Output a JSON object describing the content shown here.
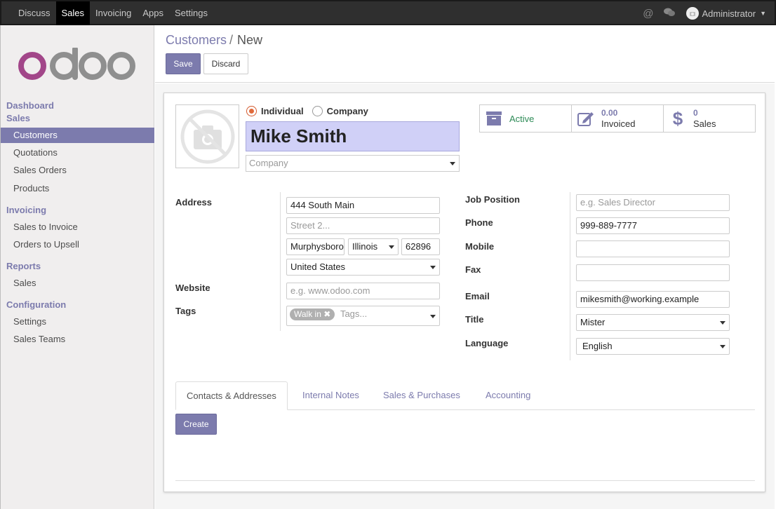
{
  "topbar": {
    "menu": [
      "Discuss",
      "Sales",
      "Invoicing",
      "Apps",
      "Settings"
    ],
    "active_menu": "Sales",
    "user": "Administrator"
  },
  "sidebar": {
    "sections": [
      {
        "label": "Dashboard"
      },
      {
        "label": "Sales",
        "items": [
          "Customers",
          "Quotations",
          "Sales Orders",
          "Products"
        ]
      },
      {
        "label": "Invoicing",
        "items": [
          "Sales to Invoice",
          "Orders to Upsell"
        ]
      },
      {
        "label": "Reports",
        "items": [
          "Sales"
        ]
      },
      {
        "label": "Configuration",
        "items": [
          "Settings",
          "Sales Teams"
        ]
      }
    ],
    "active_item": "Customers"
  },
  "breadcrumb": {
    "parent": "Customers",
    "separator": "/",
    "current": "New"
  },
  "buttons": {
    "save": "Save",
    "discard": "Discard",
    "create": "Create"
  },
  "form": {
    "type_options": [
      "Individual",
      "Company"
    ],
    "type_selected": "Individual",
    "name": "Mike Smith",
    "company_placeholder": "Company",
    "smart_buttons": {
      "active": "Active",
      "invoiced_value": "0.00",
      "invoiced_label": "Invoiced",
      "sales_value": "0",
      "sales_label": "Sales"
    },
    "labels": {
      "address": "Address",
      "website": "Website",
      "tags": "Tags",
      "job_position": "Job Position",
      "phone": "Phone",
      "mobile": "Mobile",
      "fax": "Fax",
      "email": "Email",
      "title": "Title",
      "language": "Language"
    },
    "values": {
      "street": "444 South Main",
      "street2_placeholder": "Street 2...",
      "city": "Murphysboro",
      "state": "Illinois",
      "zip": "62896",
      "country": "United States",
      "website_placeholder": "e.g. www.odoo.com",
      "tag": "Walk in",
      "tags_placeholder": "Tags...",
      "job_placeholder": "e.g. Sales Director",
      "phone": "999-889-7777",
      "mobile": "",
      "fax": "",
      "email": "mikesmith@working.example",
      "title": "Mister",
      "language": "English"
    }
  },
  "tabs": [
    "Contacts & Addresses",
    "Internal Notes",
    "Sales & Purchases",
    "Accounting"
  ],
  "active_tab": "Contacts & Addresses",
  "colors": {
    "brand": "#7c7bad",
    "name_bg": "#d0d0f7",
    "active_green": "#2e8b57",
    "logo_purple": "#a24689",
    "logo_gray": "#8f8f8f"
  }
}
